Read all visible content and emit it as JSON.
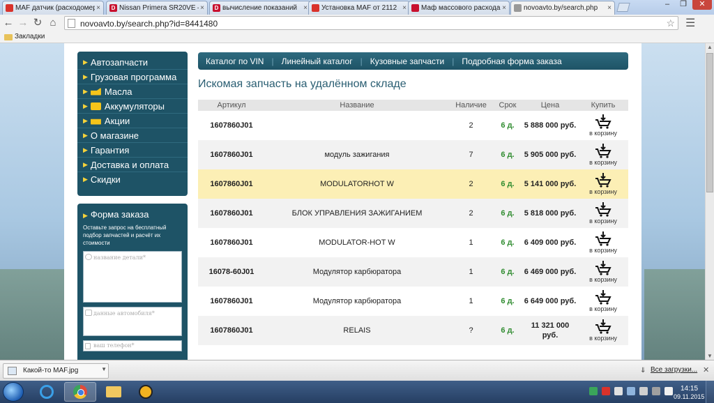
{
  "browser": {
    "tabs": [
      {
        "title": "MAF датчик (расходомер",
        "favicon_color": "#d9322b",
        "favicon": "icon"
      },
      {
        "title": "Nissan Primera SR20VE —",
        "favicon_color": "#c8102e",
        "favicon": "D"
      },
      {
        "title": "вычисление показаний",
        "favicon_color": "#c8102e",
        "favicon": "D"
      },
      {
        "title": "Установка MAF от 2112",
        "favicon_color": "#d9322b",
        "favicon": "icon"
      },
      {
        "title": "Маф массового расхода",
        "favicon_color": "#c8102e",
        "favicon": "icon"
      },
      {
        "title": "novoavto.by/search.php",
        "favicon_color": "#999999",
        "favicon": "icon",
        "active": true
      }
    ],
    "url": "novoavto.by/search.php?id=8441480",
    "bookmarks_folder": "Закладки"
  },
  "sidebar": {
    "menu": [
      {
        "label": "Автозапчасти",
        "icon": "arrow"
      },
      {
        "label": "Грузовая программа",
        "icon": "arrow"
      },
      {
        "label": "Масла",
        "icon": "oil-can-icon"
      },
      {
        "label": "Аккумуляторы",
        "icon": "battery-icon"
      },
      {
        "label": "Акции",
        "icon": "gift-icon"
      },
      {
        "label": "О магазине",
        "icon": "arrow"
      },
      {
        "label": "Гарантия",
        "icon": "arrow"
      },
      {
        "label": "Доставка и оплата",
        "icon": "arrow"
      },
      {
        "label": "Скидки",
        "icon": "arrow"
      }
    ],
    "order_form": {
      "title": "Форма заказа",
      "description": "Оставьте запрос на бесплатный подбор запчастей и расчёт их стоимости",
      "part_placeholder": "название детали*",
      "car_placeholder": "данные автомобиля*",
      "phone_placeholder": "ваш телефон*"
    }
  },
  "nav": {
    "links": [
      "Каталог по VIN",
      "Линейный каталог",
      "Кузовные запчасти",
      "Подробная форма заказа"
    ]
  },
  "main": {
    "heading": "Искомая запчасть на удалённом складе",
    "columns": [
      "Артикул",
      "Название",
      "Наличие",
      "Срок",
      "Цена",
      "Купить"
    ],
    "cart_label": "в корзину",
    "rows": [
      {
        "sku": "1607860J01",
        "name": "",
        "qty": "2",
        "term": "6 д.",
        "price": "5 888 000 руб."
      },
      {
        "sku": "1607860J01",
        "name": "модуль зажигания",
        "qty": "7",
        "term": "6 д.",
        "price": "5 905 000 руб."
      },
      {
        "sku": "1607860J01",
        "name": "MODULATORHOT W",
        "qty": "2",
        "term": "6 д.",
        "price": "5 141 000 руб.",
        "highlight": true
      },
      {
        "sku": "1607860J01",
        "name": "БЛОК УПРАВЛЕНИЯ ЗАЖИГАНИЕМ",
        "qty": "2",
        "term": "6 д.",
        "price": "5 818 000 руб."
      },
      {
        "sku": "1607860J01",
        "name": "MODULATOR-HOT W",
        "qty": "1",
        "term": "6 д.",
        "price": "6 409 000 руб."
      },
      {
        "sku": "16078-60J01",
        "name": "Модулятор карбюратора",
        "qty": "1",
        "term": "6 д.",
        "price": "6 469 000 руб."
      },
      {
        "sku": "1607860J01",
        "name": "Модулятор карбюратора",
        "qty": "1",
        "term": "6 д.",
        "price": "6 649 000 руб."
      },
      {
        "sku": "1607860J01",
        "name": "RELAIS",
        "qty": "?",
        "term": "6 д.",
        "price": "11 321 000 руб."
      }
    ]
  },
  "downloads": {
    "file_name": "Какой-то MAF.jpg",
    "all_label": "Все загрузки..."
  },
  "taskbar": {
    "time": "14:15",
    "date": "09.11.2015"
  },
  "colors": {
    "accent": "#1e5366",
    "highlight_row": "#fcefb5",
    "term_green": "#2e8b2e"
  }
}
